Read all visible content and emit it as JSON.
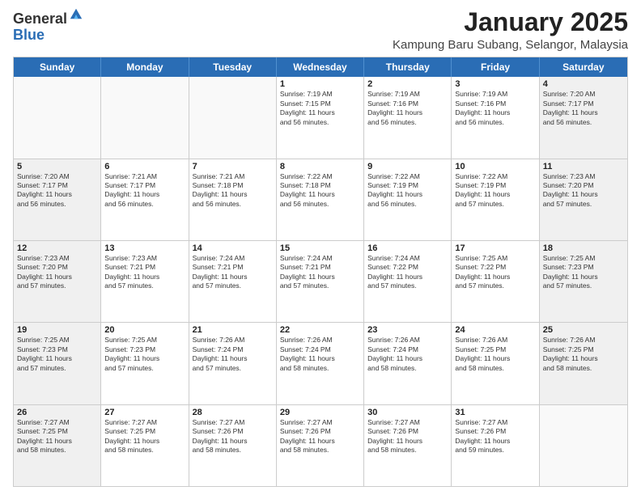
{
  "logo": {
    "general": "General",
    "blue": "Blue"
  },
  "header": {
    "title": "January 2025",
    "subtitle": "Kampung Baru Subang, Selangor, Malaysia"
  },
  "weekdays": [
    "Sunday",
    "Monday",
    "Tuesday",
    "Wednesday",
    "Thursday",
    "Friday",
    "Saturday"
  ],
  "weeks": [
    [
      {
        "day": "",
        "info": "",
        "empty": true
      },
      {
        "day": "",
        "info": "",
        "empty": true
      },
      {
        "day": "",
        "info": "",
        "empty": true
      },
      {
        "day": "1",
        "info": "Sunrise: 7:19 AM\nSunset: 7:15 PM\nDaylight: 11 hours\nand 56 minutes.",
        "empty": false
      },
      {
        "day": "2",
        "info": "Sunrise: 7:19 AM\nSunset: 7:16 PM\nDaylight: 11 hours\nand 56 minutes.",
        "empty": false
      },
      {
        "day": "3",
        "info": "Sunrise: 7:19 AM\nSunset: 7:16 PM\nDaylight: 11 hours\nand 56 minutes.",
        "empty": false
      },
      {
        "day": "4",
        "info": "Sunrise: 7:20 AM\nSunset: 7:17 PM\nDaylight: 11 hours\nand 56 minutes.",
        "empty": false
      }
    ],
    [
      {
        "day": "5",
        "info": "Sunrise: 7:20 AM\nSunset: 7:17 PM\nDaylight: 11 hours\nand 56 minutes.",
        "empty": false
      },
      {
        "day": "6",
        "info": "Sunrise: 7:21 AM\nSunset: 7:17 PM\nDaylight: 11 hours\nand 56 minutes.",
        "empty": false
      },
      {
        "day": "7",
        "info": "Sunrise: 7:21 AM\nSunset: 7:18 PM\nDaylight: 11 hours\nand 56 minutes.",
        "empty": false
      },
      {
        "day": "8",
        "info": "Sunrise: 7:22 AM\nSunset: 7:18 PM\nDaylight: 11 hours\nand 56 minutes.",
        "empty": false
      },
      {
        "day": "9",
        "info": "Sunrise: 7:22 AM\nSunset: 7:19 PM\nDaylight: 11 hours\nand 56 minutes.",
        "empty": false
      },
      {
        "day": "10",
        "info": "Sunrise: 7:22 AM\nSunset: 7:19 PM\nDaylight: 11 hours\nand 57 minutes.",
        "empty": false
      },
      {
        "day": "11",
        "info": "Sunrise: 7:23 AM\nSunset: 7:20 PM\nDaylight: 11 hours\nand 57 minutes.",
        "empty": false
      }
    ],
    [
      {
        "day": "12",
        "info": "Sunrise: 7:23 AM\nSunset: 7:20 PM\nDaylight: 11 hours\nand 57 minutes.",
        "empty": false
      },
      {
        "day": "13",
        "info": "Sunrise: 7:23 AM\nSunset: 7:21 PM\nDaylight: 11 hours\nand 57 minutes.",
        "empty": false
      },
      {
        "day": "14",
        "info": "Sunrise: 7:24 AM\nSunset: 7:21 PM\nDaylight: 11 hours\nand 57 minutes.",
        "empty": false
      },
      {
        "day": "15",
        "info": "Sunrise: 7:24 AM\nSunset: 7:21 PM\nDaylight: 11 hours\nand 57 minutes.",
        "empty": false
      },
      {
        "day": "16",
        "info": "Sunrise: 7:24 AM\nSunset: 7:22 PM\nDaylight: 11 hours\nand 57 minutes.",
        "empty": false
      },
      {
        "day": "17",
        "info": "Sunrise: 7:25 AM\nSunset: 7:22 PM\nDaylight: 11 hours\nand 57 minutes.",
        "empty": false
      },
      {
        "day": "18",
        "info": "Sunrise: 7:25 AM\nSunset: 7:23 PM\nDaylight: 11 hours\nand 57 minutes.",
        "empty": false
      }
    ],
    [
      {
        "day": "19",
        "info": "Sunrise: 7:25 AM\nSunset: 7:23 PM\nDaylight: 11 hours\nand 57 minutes.",
        "empty": false
      },
      {
        "day": "20",
        "info": "Sunrise: 7:25 AM\nSunset: 7:23 PM\nDaylight: 11 hours\nand 57 minutes.",
        "empty": false
      },
      {
        "day": "21",
        "info": "Sunrise: 7:26 AM\nSunset: 7:24 PM\nDaylight: 11 hours\nand 57 minutes.",
        "empty": false
      },
      {
        "day": "22",
        "info": "Sunrise: 7:26 AM\nSunset: 7:24 PM\nDaylight: 11 hours\nand 58 minutes.",
        "empty": false
      },
      {
        "day": "23",
        "info": "Sunrise: 7:26 AM\nSunset: 7:24 PM\nDaylight: 11 hours\nand 58 minutes.",
        "empty": false
      },
      {
        "day": "24",
        "info": "Sunrise: 7:26 AM\nSunset: 7:25 PM\nDaylight: 11 hours\nand 58 minutes.",
        "empty": false
      },
      {
        "day": "25",
        "info": "Sunrise: 7:26 AM\nSunset: 7:25 PM\nDaylight: 11 hours\nand 58 minutes.",
        "empty": false
      }
    ],
    [
      {
        "day": "26",
        "info": "Sunrise: 7:27 AM\nSunset: 7:25 PM\nDaylight: 11 hours\nand 58 minutes.",
        "empty": false
      },
      {
        "day": "27",
        "info": "Sunrise: 7:27 AM\nSunset: 7:25 PM\nDaylight: 11 hours\nand 58 minutes.",
        "empty": false
      },
      {
        "day": "28",
        "info": "Sunrise: 7:27 AM\nSunset: 7:26 PM\nDaylight: 11 hours\nand 58 minutes.",
        "empty": false
      },
      {
        "day": "29",
        "info": "Sunrise: 7:27 AM\nSunset: 7:26 PM\nDaylight: 11 hours\nand 58 minutes.",
        "empty": false
      },
      {
        "day": "30",
        "info": "Sunrise: 7:27 AM\nSunset: 7:26 PM\nDaylight: 11 hours\nand 58 minutes.",
        "empty": false
      },
      {
        "day": "31",
        "info": "Sunrise: 7:27 AM\nSunset: 7:26 PM\nDaylight: 11 hours\nand 59 minutes.",
        "empty": false
      },
      {
        "day": "",
        "info": "",
        "empty": true
      }
    ]
  ]
}
